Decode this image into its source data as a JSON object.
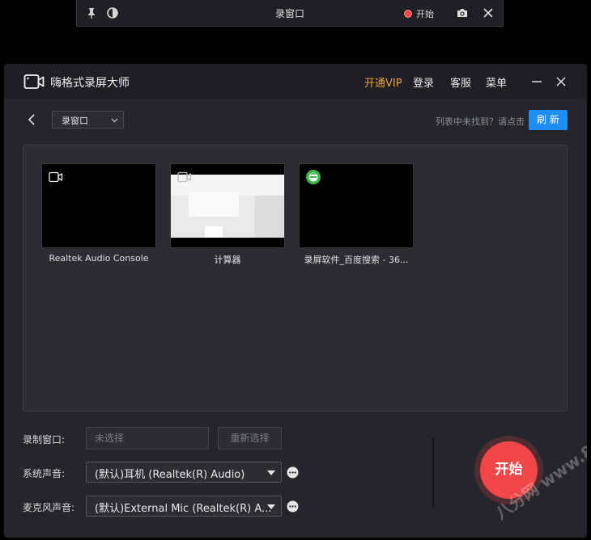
{
  "floatbar": {
    "title": "录窗口",
    "start_label": "开始"
  },
  "window": {
    "app_title": "嗨格式录屏大师",
    "menu": {
      "vip": "开通VIP",
      "login": "登录",
      "service": "客服",
      "menu": "菜单"
    }
  },
  "toolbar": {
    "mode_value": "录窗口",
    "hint": "列表中未找到？请点击",
    "refresh_label": "刷 新"
  },
  "windows_list": [
    {
      "label": "Realtek Audio Console"
    },
    {
      "label": "计算器"
    },
    {
      "label": "录屏软件_百度搜索 - 36..."
    }
  ],
  "settings": {
    "record_window_label": "录制窗口:",
    "record_window_placeholder": "未选择",
    "reselect_label": "重新选择",
    "system_audio_label": "系统声音:",
    "system_audio_value": "(默认)耳机 (Realtek(R) Audio)",
    "mic_label": "麦克风声音:",
    "mic_value": "(默认)External Mic (Realtek(R) A..."
  },
  "start_button": "开始",
  "watermark": "八分网 www.8fe.com",
  "colors": {
    "accent_blue": "#1e8df5",
    "vip_orange": "#f0a232",
    "record_red": "#f04848"
  },
  "icons": [
    "pin-icon",
    "contrast-icon",
    "record-dot-icon",
    "camera-icon",
    "close-icon",
    "logo-camera-icon",
    "minimize-icon",
    "back-icon",
    "chevron-down-icon",
    "browser-icon",
    "more-icon"
  ]
}
